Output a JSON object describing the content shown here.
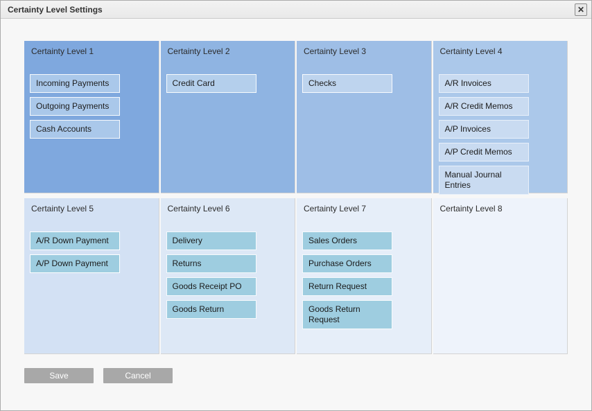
{
  "window": {
    "title": "Certainty Level Settings",
    "close_icon": "✕"
  },
  "levels": [
    {
      "title": "Certainty Level 1",
      "items": [
        "Incoming Payments",
        "Outgoing Payments",
        "Cash Accounts"
      ]
    },
    {
      "title": "Certainty Level 2",
      "items": [
        "Credit Card"
      ]
    },
    {
      "title": "Certainty Level 3",
      "items": [
        "Checks"
      ]
    },
    {
      "title": "Certainty Level 4",
      "items": [
        "A/R Invoices",
        "A/R Credit Memos",
        "A/P Invoices",
        "A/P Credit Memos",
        "Manual Journal Entries"
      ]
    },
    {
      "title": "Certainty Level 5",
      "items": [
        "A/R Down Payment",
        "A/P Down Payment"
      ]
    },
    {
      "title": "Certainty Level 6",
      "items": [
        "Delivery",
        "Returns",
        "Goods Receipt PO",
        "Goods Return"
      ]
    },
    {
      "title": "Certainty Level 7",
      "items": [
        "Sales Orders",
        "Purchase Orders",
        "Return Request",
        "Goods Return Request"
      ]
    },
    {
      "title": "Certainty Level 8",
      "items": []
    }
  ],
  "footer": {
    "save": "Save",
    "cancel": "Cancel"
  }
}
